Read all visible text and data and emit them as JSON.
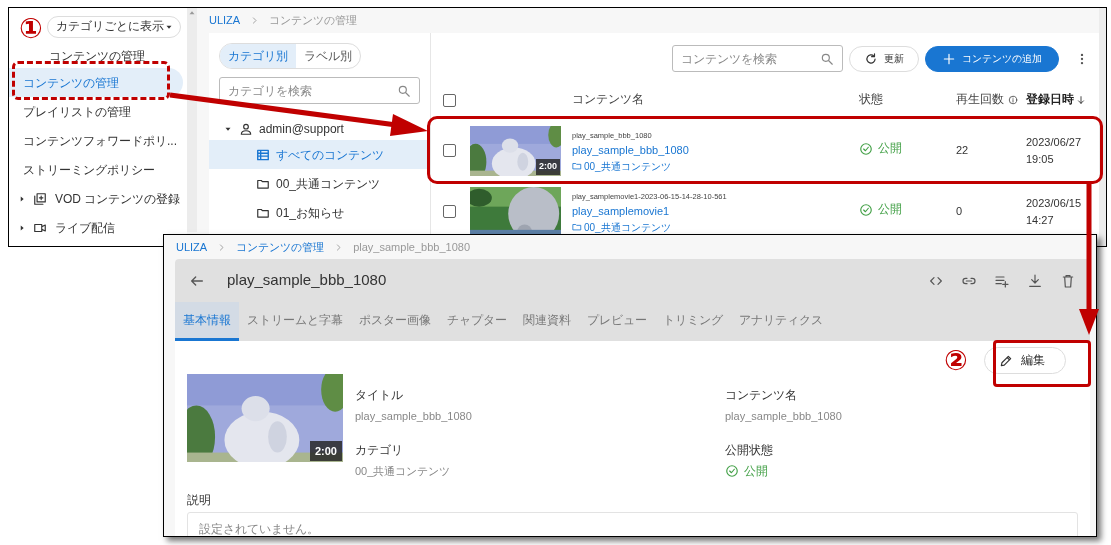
{
  "markers": [
    "①",
    "②"
  ],
  "list_screen": {
    "sidebar": {
      "view_selector": "カテゴリごとに表示",
      "items": [
        {
          "kind": "header",
          "label": "コンテンツの管理",
          "selected": false
        },
        {
          "kind": "item",
          "label": "コンテンツの管理",
          "selected": true
        },
        {
          "kind": "item",
          "label": "プレイリストの管理",
          "selected": false
        },
        {
          "kind": "item",
          "label": "コンテンツフォワードポリ...",
          "selected": false
        },
        {
          "kind": "item",
          "label": "ストリーミングポリシー",
          "selected": false
        },
        {
          "kind": "group",
          "label": "VOD コンテンツの登録",
          "expanded": false
        },
        {
          "kind": "group",
          "label": "ライブ配信",
          "expanded": false
        }
      ]
    },
    "breadcrumb": [
      "ULIZA",
      "コンテンツの管理"
    ],
    "category_panel": {
      "tabs": [
        {
          "label": "カテゴリ別",
          "selected": true
        },
        {
          "label": "ラベル別",
          "selected": false
        }
      ],
      "search": {
        "placeholder": "カテゴリを検索"
      },
      "tree": [
        {
          "kind": "user",
          "label": "admin@support",
          "expanded": true,
          "selected": false,
          "children": [
            {
              "kind": "all",
              "label": "すべてのコンテンツ",
              "selected": true
            },
            {
              "kind": "folder",
              "label": "00_共通コンテンツ",
              "selected": false
            },
            {
              "kind": "folder",
              "label": "01_お知らせ",
              "selected": false
            }
          ]
        }
      ]
    },
    "content_panel": {
      "search": {
        "placeholder": "コンテンツを検索"
      },
      "buttons": [
        {
          "kind": "refresh",
          "label": "更新"
        },
        {
          "kind": "add",
          "label": "コンテンツの追加"
        }
      ],
      "table": {
        "all_checked": false,
        "columns": [
          {
            "label": "コンテンツ名"
          },
          {
            "label": "状態"
          },
          {
            "label": "再生回数",
            "info": true
          },
          {
            "label": "登録日時",
            "sort_descending": true
          }
        ],
        "rows": [
          {
            "checked": false,
            "file_name": "play_sample_bbb_1080",
            "title": "play_sample_bbb_1080",
            "category": "00_共通コンテンツ",
            "duration": "2:00",
            "status": {
              "kind": "published",
              "label": "公開"
            },
            "plays": "22",
            "date": "2023/06/27",
            "time": "19:05"
          },
          {
            "checked": false,
            "file_name": "play_samplemovie1-2023-06-15-14-28-10-561",
            "title": "play_samplemovie1",
            "category": "00_共通コンテンツ",
            "status": {
              "kind": "published",
              "label": "公開"
            },
            "plays": "0",
            "date": "2023/06/15",
            "time": "14:27"
          }
        ]
      }
    }
  },
  "detail_screen": {
    "breadcrumb": [
      "ULIZA",
      "コンテンツの管理",
      "play_sample_bbb_1080"
    ],
    "title": "play_sample_bbb_1080",
    "tabs": [
      {
        "label": "基本情報",
        "selected": true
      },
      {
        "label": "ストリームと字幕",
        "selected": false
      },
      {
        "label": "ポスター画像",
        "selected": false
      },
      {
        "label": "チャプター",
        "selected": false
      },
      {
        "label": "関連資料",
        "selected": false
      },
      {
        "label": "プレビュー",
        "selected": false
      },
      {
        "label": "トリミング",
        "selected": false
      },
      {
        "label": "アナリティクス",
        "selected": false
      }
    ],
    "edit_button": "編集",
    "thumbnail": {
      "duration": "2:00"
    },
    "fields": [
      {
        "label": "タイトル",
        "value": "play_sample_bbb_1080"
      },
      {
        "label": "コンテンツ名",
        "value": "play_sample_bbb_1080"
      },
      {
        "label": "カテゴリ",
        "value": "00_共通コンテンツ"
      },
      {
        "label": "公開状態",
        "value": "公開",
        "kind": "status"
      }
    ],
    "description": {
      "label": "説明",
      "text": "設定されていません。"
    }
  }
}
